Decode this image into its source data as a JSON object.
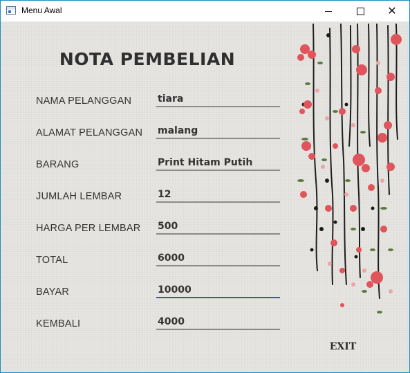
{
  "window": {
    "title": "Menu Awal"
  },
  "heading": "NOTA PEMBELIAN",
  "fields": [
    {
      "label": "NAMA PELANGGAN",
      "value": "tiara"
    },
    {
      "label": "ALAMAT PELANGGAN",
      "value": "malang"
    },
    {
      "label": "BARANG",
      "value": "Print Hitam Putih"
    },
    {
      "label": "JUMLAH LEMBAR",
      "value": "12"
    },
    {
      "label": "HARGA PER LEMBAR",
      "value": "500"
    },
    {
      "label": "TOTAL",
      "value": "6000"
    },
    {
      "label": "BAYAR",
      "value": "10000"
    },
    {
      "label": "KEMBALI",
      "value": "4000"
    }
  ],
  "exit_label": "EXIT",
  "colors": {
    "window_border": "#1b8fbf",
    "active_underline": "#3e5897",
    "underline": "#8b8b8b",
    "flower": "#e0545c",
    "background": "#e6e5e1"
  },
  "icons": [
    "app-window-icon",
    "minimize-icon",
    "maximize-icon",
    "close-icon",
    "floral-decoration"
  ]
}
